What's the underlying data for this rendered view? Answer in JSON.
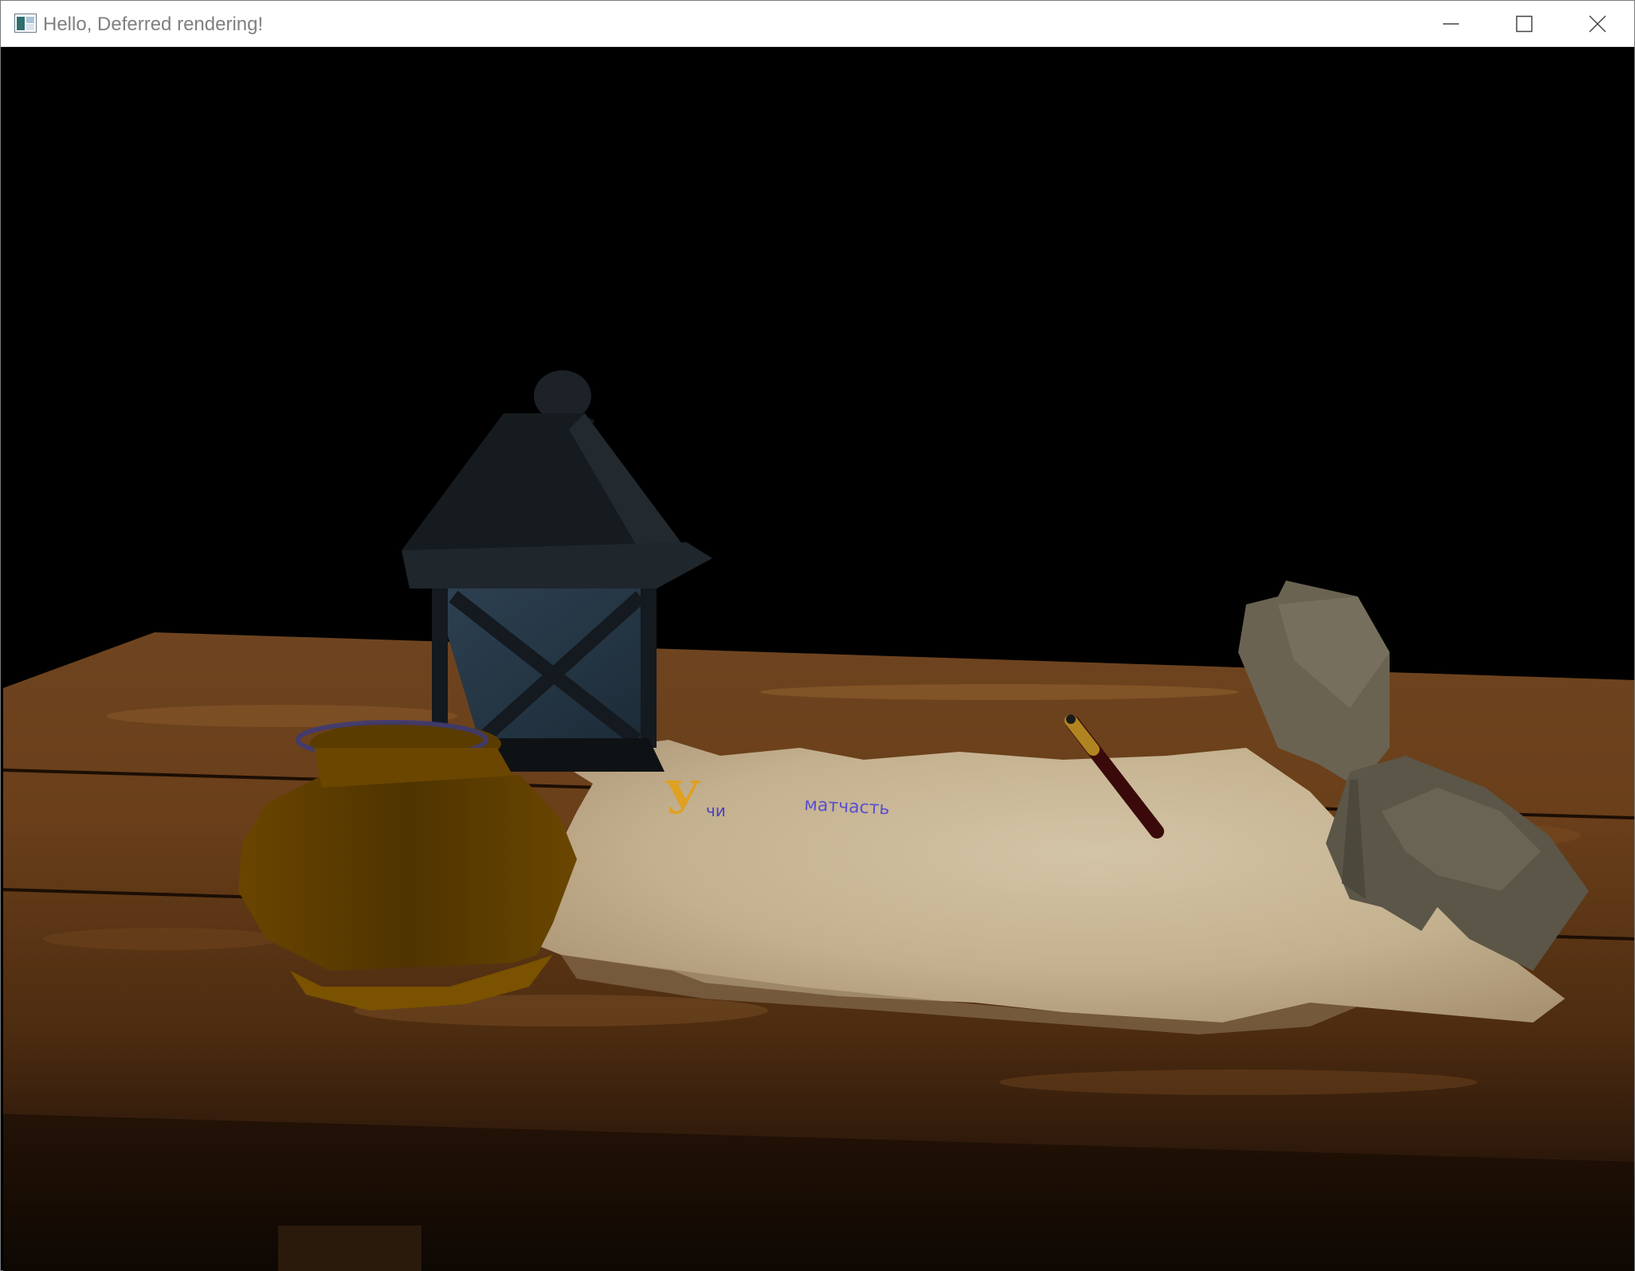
{
  "window": {
    "title": "Hello, Deferred rendering!",
    "icon": "app-window-icon",
    "controls": {
      "minimize": "minimize-icon",
      "maximize": "maximize-icon",
      "close": "close-icon"
    }
  },
  "scene": {
    "parchment_text": {
      "initial": "У",
      "word1": "чи",
      "word2": "матчасть"
    },
    "colors": {
      "background": "#000000",
      "table": "#6b3f18",
      "parchment": "#c9b89a",
      "ink_jar": "#7a5200",
      "lantern": "#1a2630",
      "quill": "#6b6352",
      "pen": "#3a0a0a",
      "initial": "#e0a020",
      "text": "#4a40c0"
    }
  }
}
